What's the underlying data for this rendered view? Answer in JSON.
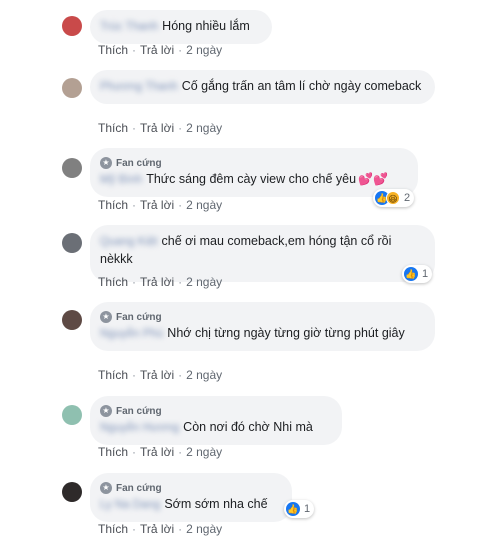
{
  "actions": {
    "like": "Thích",
    "reply": "Trả lời",
    "time": "2 ngày",
    "separator": "·"
  },
  "badge_label": "Fan cứng",
  "colors": {
    "bubble": "#f2f3f5",
    "like_blue": "#1877f2",
    "haha_yellow": "#f7b125",
    "meta_gray": "#606770"
  },
  "comments": [
    {
      "author": "Trúc Thanh",
      "text": "Hóng nhiều lắm",
      "avatar_color": "#c94a4a"
    },
    {
      "author": "Phương Thanh",
      "text": "Cố gắng trấn an tâm lí chờ ngày comeback",
      "avatar_color": "#b3a093"
    },
    {
      "author": "Mỹ Bình",
      "text": "Thức sáng đêm cày view cho chế yêu",
      "avatar_color": "#808080",
      "reaction_count": "2"
    },
    {
      "author": "Quang Kiệt",
      "text": "chế ơi mau comeback,em hóng tận cổ rồi nèkkk",
      "avatar_color": "#6b6f76",
      "reaction_count": "1"
    },
    {
      "author": "Nguyễn Phú",
      "text": "Nhớ chị từng ngày từng giờ từng phút giây",
      "avatar_color": "#5e4a45"
    },
    {
      "author": "Nguyễn Hương",
      "text": "Còn nơi đó chờ Nhi mà",
      "avatar_color": "#8fc0b0"
    },
    {
      "author": "Ly Na Dang",
      "text": "Sớm sớm nha chế",
      "avatar_color": "#2e2a2a",
      "reaction_count": "1"
    }
  ]
}
